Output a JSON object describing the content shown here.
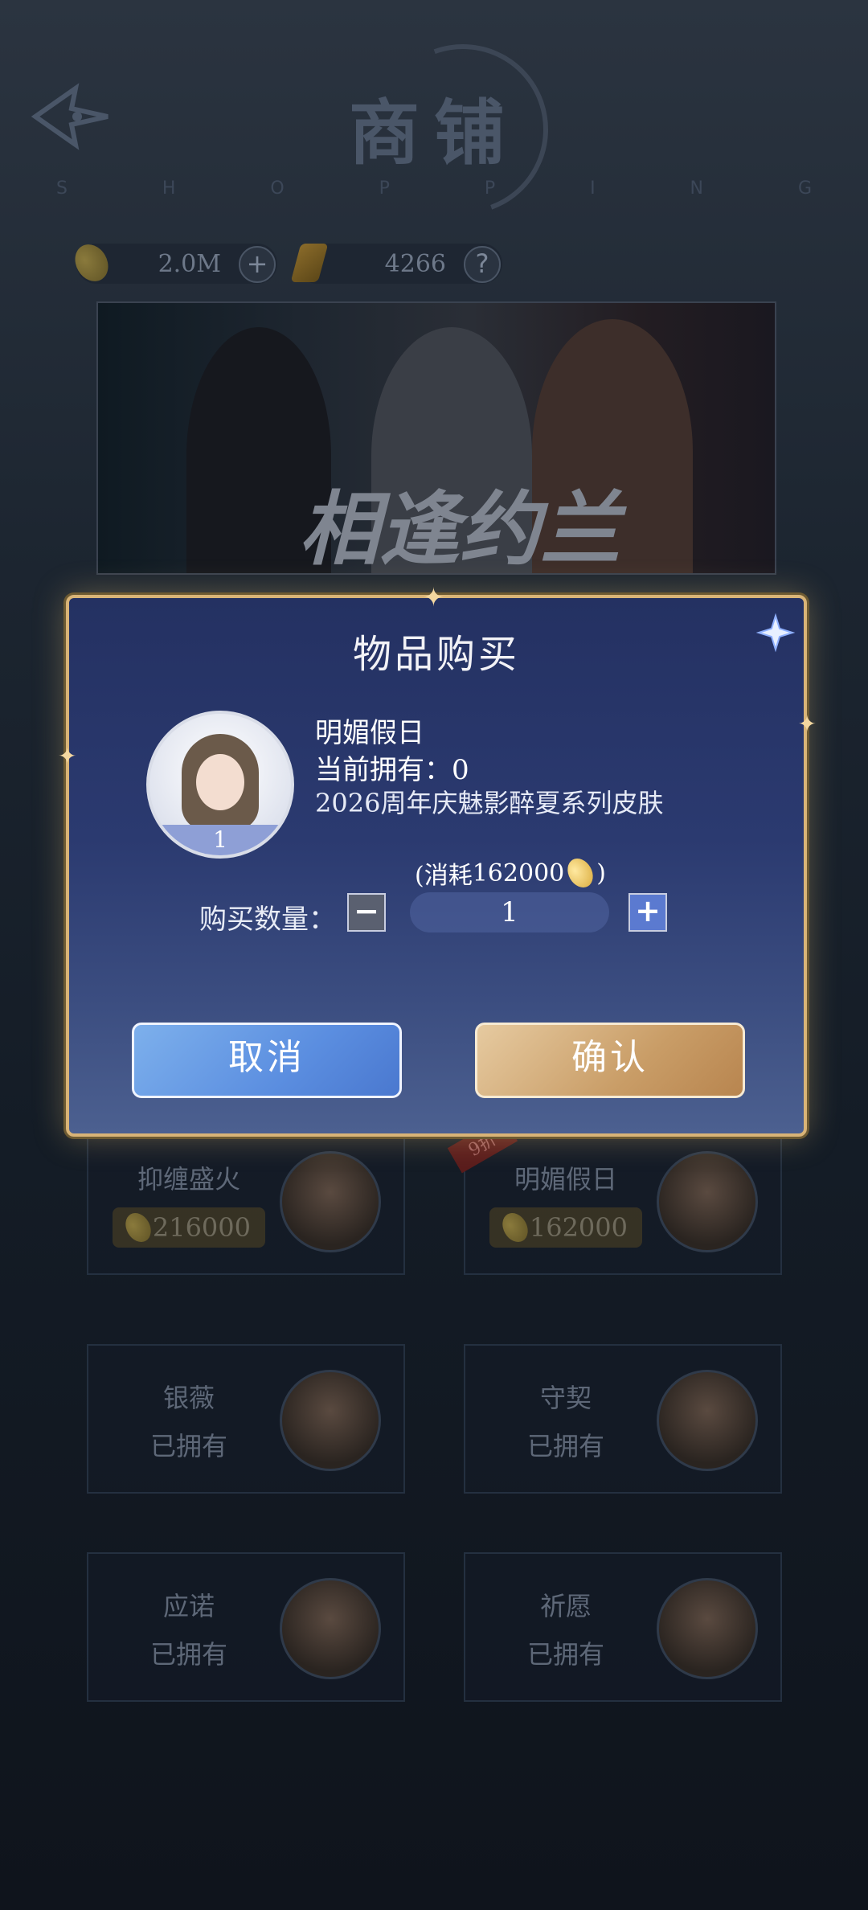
{
  "header": {
    "title": "商铺",
    "subtitle_letters": [
      "S",
      "H",
      "O",
      "P",
      "P",
      "I",
      "N",
      "G"
    ]
  },
  "currency": {
    "gold_value": "2.0M",
    "gem_value": "4266",
    "add_symbol": "+",
    "help_symbol": "?"
  },
  "banner": {
    "title": "相逢约兰"
  },
  "modal": {
    "title": "物品购买",
    "item_name": "明媚假日",
    "owned": "当前拥有：0",
    "description": "2026周年庆魅影醉夏系列皮肤",
    "avatar_qty": "1",
    "cost_prefix": "(消耗",
    "cost_value": "162000",
    "cost_suffix": ")",
    "qty_label": "购买数量：",
    "qty_value": "1",
    "minus": "−",
    "plus": "+",
    "cancel_label": "取消",
    "confirm_label": "确认"
  },
  "cards": [
    {
      "name": "抑缠盛火",
      "price": "216000"
    },
    {
      "name": "明媚假日",
      "price": "162000",
      "badge": "9折"
    },
    {
      "name": "银薇",
      "status": "已拥有"
    },
    {
      "name": "守契",
      "status": "已拥有"
    },
    {
      "name": "应诺",
      "status": "已拥有"
    },
    {
      "name": "祈愿",
      "status": "已拥有"
    }
  ]
}
